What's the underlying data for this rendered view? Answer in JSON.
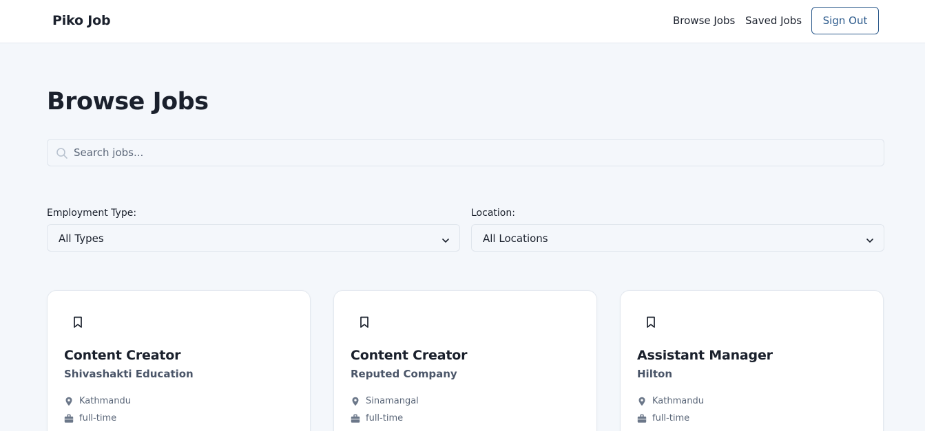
{
  "nav": {
    "brand": "Piko Job",
    "browse_label": "Browse Jobs",
    "saved_label": "Saved Jobs",
    "signout_label": "Sign Out"
  },
  "page": {
    "title": "Browse Jobs"
  },
  "search": {
    "placeholder": "Search jobs...",
    "value": ""
  },
  "filters": {
    "employment_label": "Employment Type:",
    "employment_value": "All Types",
    "location_label": "Location:",
    "location_value": "All Locations"
  },
  "jobs": [
    {
      "title": "Content Creator",
      "company": "Shivashakti Education",
      "location": "Kathmandu",
      "type": "full-time"
    },
    {
      "title": "Content Creator",
      "company": "Reputed Company",
      "location": "Sinamangal",
      "type": "full-time"
    },
    {
      "title": "Assistant Manager",
      "company": "Hilton",
      "location": "Kathmandu",
      "type": "full-time"
    }
  ],
  "colors": {
    "accent": "#2c5a8c",
    "background": "#f4f7fb",
    "muted_text": "#5a6678"
  }
}
